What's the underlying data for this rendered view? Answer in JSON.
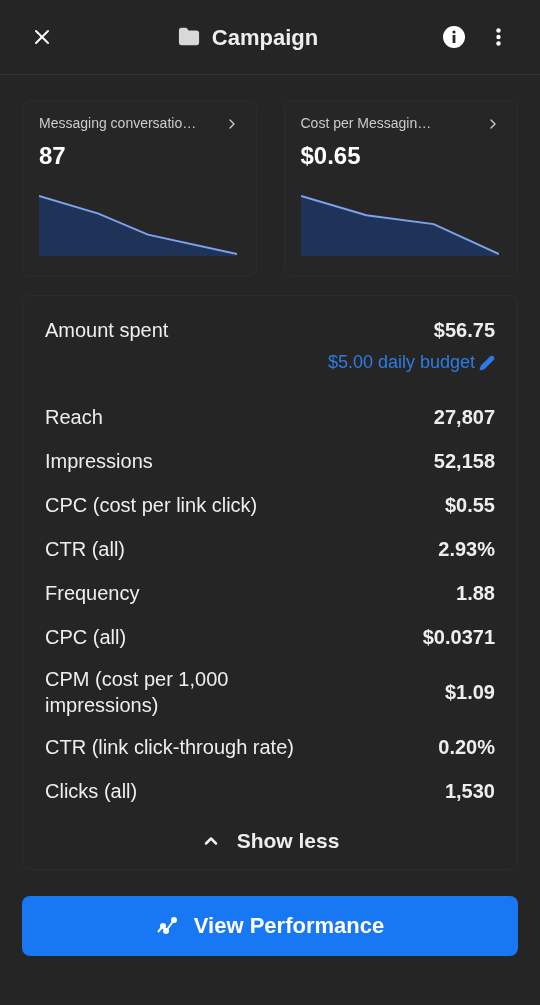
{
  "header": {
    "title": "Campaign"
  },
  "cards": [
    {
      "label": "Messaging conversatio…",
      "value": "87"
    },
    {
      "label": "Cost per Messagin…",
      "value": "$0.65"
    }
  ],
  "metrics": [
    {
      "label": "Amount spent",
      "value": "$56.75",
      "link": "$5.00 daily budget"
    },
    {
      "label": "Reach",
      "value": "27,807"
    },
    {
      "label": "Impressions",
      "value": "52,158"
    },
    {
      "label": "CPC (cost per link click)",
      "value": "$0.55"
    },
    {
      "label": "CTR (all)",
      "value": "2.93%"
    },
    {
      "label": "Frequency",
      "value": "1.88"
    },
    {
      "label": "CPC (all)",
      "value": "$0.0371"
    },
    {
      "label": "CPM (cost per 1,000 impressions)",
      "value": "$1.09"
    },
    {
      "label": "CTR (link click-through rate)",
      "value": "0.20%"
    },
    {
      "label": "Clicks (all)",
      "value": "1,530"
    }
  ],
  "toggle": {
    "label": "Show less",
    "expanded": true
  },
  "action": {
    "label": "View Performance"
  }
}
